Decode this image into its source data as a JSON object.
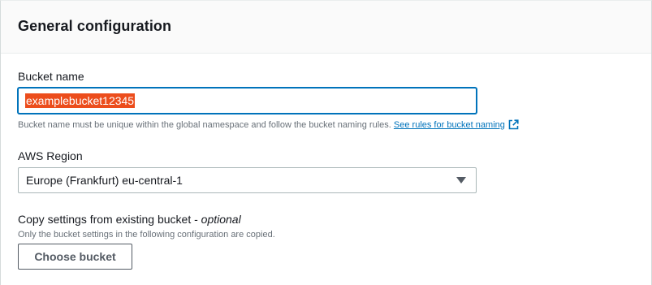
{
  "panel": {
    "title": "General configuration"
  },
  "bucket_name": {
    "label": "Bucket name",
    "value": "examplebucket12345",
    "hint": "Bucket name must be unique within the global namespace and follow the bucket naming rules.",
    "link_text": "See rules for bucket naming",
    "link_icon": "external-link-icon"
  },
  "region": {
    "label": "AWS Region",
    "selected": "Europe (Frankfurt) eu-central-1"
  },
  "copy_settings": {
    "label": "Copy settings from existing bucket - ",
    "label_optional": "optional",
    "hint": "Only the bucket settings in the following configuration are copied.",
    "button_label": "Choose bucket"
  },
  "colors": {
    "accent": "#0073bb",
    "selection": "#ec4d1c",
    "border": "#aab7b8"
  }
}
